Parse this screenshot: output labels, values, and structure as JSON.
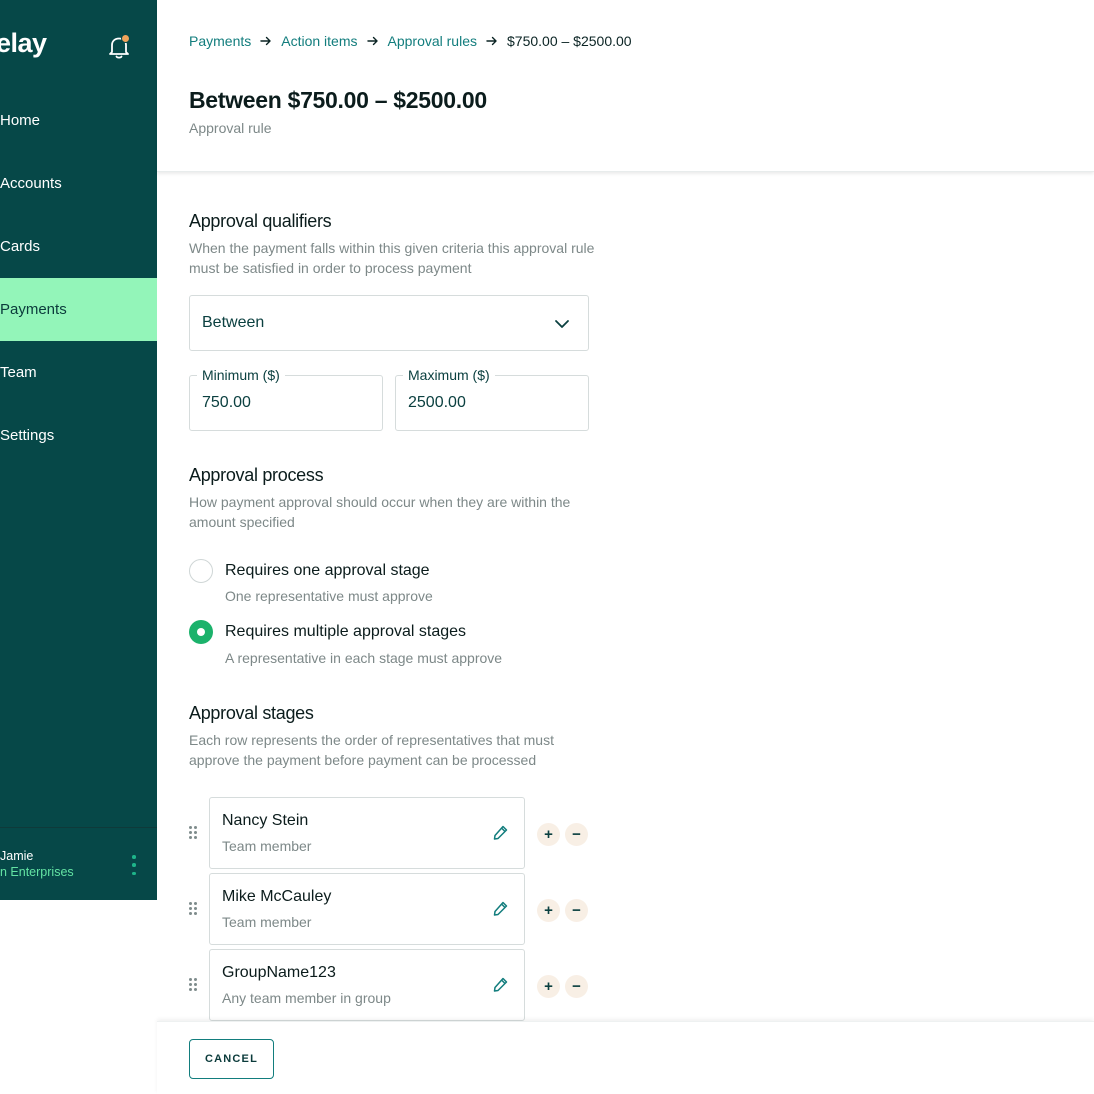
{
  "sidebar": {
    "logo": "elay",
    "nav": [
      {
        "label": "Home",
        "active": false
      },
      {
        "label": "Accounts",
        "active": false
      },
      {
        "label": "Cards",
        "active": false
      },
      {
        "label": "Payments",
        "active": true
      },
      {
        "label": "Team",
        "active": false
      },
      {
        "label": "Settings",
        "active": false
      }
    ],
    "user": {
      "name": "Jamie",
      "org": "n Enterprises"
    }
  },
  "breadcrumb": {
    "items": [
      "Payments",
      "Action items",
      "Approval rules"
    ],
    "current": "$750.00 – $2500.00"
  },
  "header": {
    "title": "Between $750.00 – $2500.00",
    "subtitle": "Approval rule"
  },
  "qualifiers": {
    "title": "Approval qualifiers",
    "desc": "When the payment falls within this given criteria this approval rule must be satisfied in order to process payment",
    "select_value": "Between",
    "min_label": "Minimum ($)",
    "min_value": "750.00",
    "max_label": "Maximum ($)",
    "max_value": "2500.00"
  },
  "process": {
    "title": "Approval process",
    "desc": "How payment approval should occur when they are within the amount specified",
    "options": [
      {
        "label": "Requires one approval stage",
        "help": "One representative must approve",
        "checked": false
      },
      {
        "label": "Requires multiple approval stages",
        "help": "A representative in each stage must approve",
        "checked": true
      }
    ]
  },
  "stages": {
    "title": "Approval stages",
    "desc": "Each row represents the order of representatives that must approve the payment before payment can be processed",
    "rows": [
      {
        "name": "Nancy Stein",
        "role": "Team member"
      },
      {
        "name": "Mike McCauley",
        "role": "Team member"
      },
      {
        "name": "GroupName123",
        "role": "Any team member in group"
      }
    ],
    "plus": "+",
    "minus": "−"
  },
  "footer": {
    "cancel_label": "CANCEL"
  },
  "colors": {
    "sidebar_bg": "#064848",
    "active_nav": "#93f5b9",
    "accent": "#127d7d",
    "radio_checked": "#1bb26b",
    "notification_dot": "#f0a35a"
  },
  "icons": {
    "bell": "bell-icon",
    "chevron": "chevron-down-icon",
    "edit": "pencil-icon",
    "drag": "drag-handle-icon",
    "breadcrumb_separator": "arrow-right-icon"
  }
}
